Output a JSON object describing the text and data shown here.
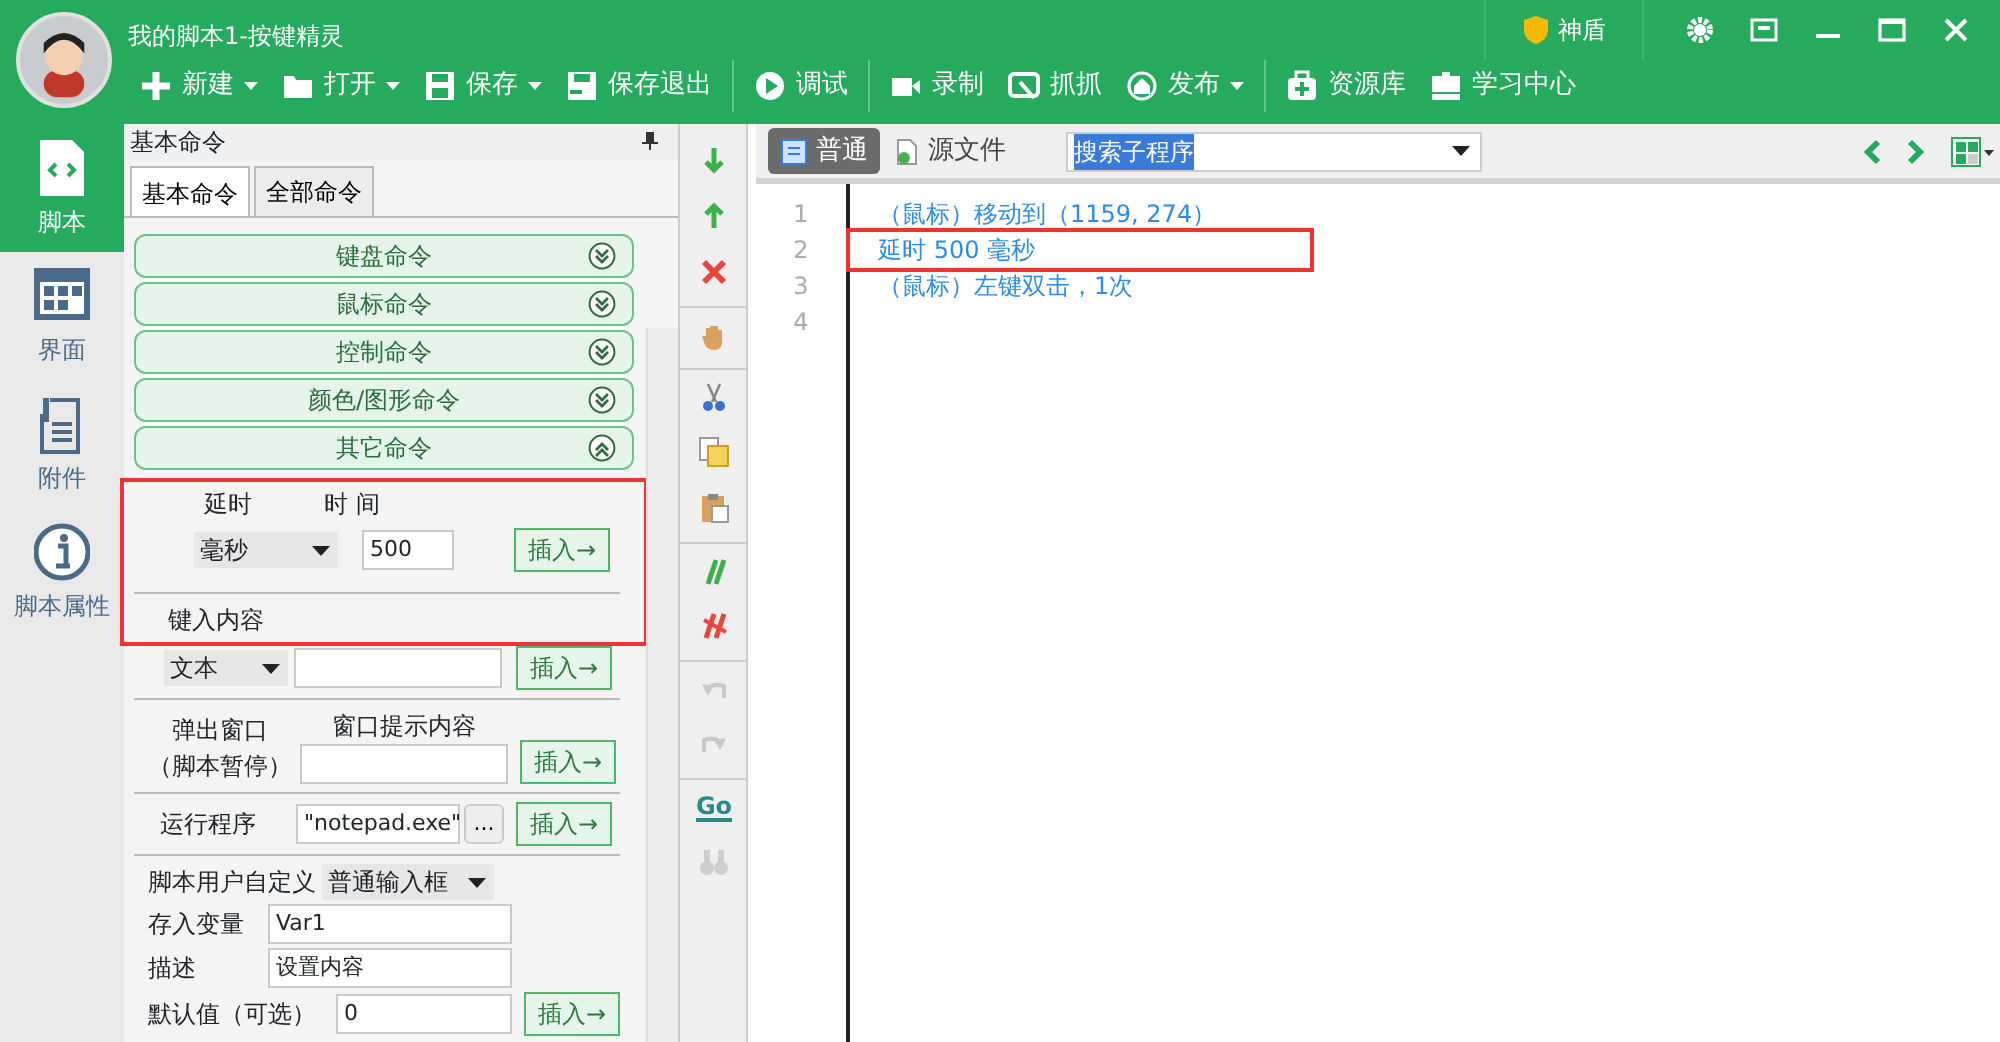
{
  "window": {
    "title": "我的脚本1-按键精灵",
    "shield": "神盾"
  },
  "toolbar": [
    {
      "label": "新建",
      "dropdown": true,
      "separator_before": false
    },
    {
      "label": "打开",
      "dropdown": true,
      "separator_before": false
    },
    {
      "label": "保存",
      "dropdown": true,
      "separator_before": false
    },
    {
      "label": "保存退出",
      "dropdown": false,
      "separator_before": false
    },
    {
      "label": "调试",
      "dropdown": false,
      "separator_before": true
    },
    {
      "label": "录制",
      "dropdown": false,
      "separator_before": true
    },
    {
      "label": "抓抓",
      "dropdown": false,
      "separator_before": false
    },
    {
      "label": "发布",
      "dropdown": true,
      "separator_before": false
    },
    {
      "label": "资源库",
      "dropdown": false,
      "separator_before": true
    },
    {
      "label": "学习中心",
      "dropdown": false,
      "separator_before": false
    }
  ],
  "sidebar": {
    "items": [
      {
        "label": "脚本",
        "selected": true
      },
      {
        "label": "界面",
        "selected": false
      },
      {
        "label": "附件",
        "selected": false
      },
      {
        "label": "脚本属性",
        "selected": false
      }
    ]
  },
  "panel": {
    "title": "基本命令",
    "tabs": [
      {
        "label": "基本命令",
        "selected": true
      },
      {
        "label": "全部命令",
        "selected": false
      }
    ],
    "categories": [
      {
        "label": "键盘命令",
        "expanded": false
      },
      {
        "label": "鼠标命令",
        "expanded": false
      },
      {
        "label": "控制命令",
        "expanded": false
      },
      {
        "label": "颜色/图形命令",
        "expanded": false
      },
      {
        "label": "其它命令",
        "expanded": true
      }
    ],
    "delay": {
      "label": "延时",
      "time_label": "时 间",
      "unit": "毫秒",
      "value": "500",
      "button": "插入→",
      "highlighted": true
    },
    "keyin": {
      "label": "键入内容",
      "type": "文本",
      "button": "插入→"
    },
    "popup": {
      "label_1": "弹出窗口",
      "label_2": "（脚本暂停）",
      "content_label": "窗口提示内容",
      "button": "插入→"
    },
    "run": {
      "label": "运行程序",
      "value": "\"notepad.exe\"",
      "browse": "...",
      "button": "插入→"
    },
    "custom": {
      "label": "脚本用户自定义",
      "type": "普通输入框",
      "fields": [
        {
          "label": "存入变量",
          "value": "Var1"
        },
        {
          "label": "描述",
          "value": "设置内容"
        },
        {
          "label": "默认值（可选）",
          "value": "0"
        }
      ],
      "button": "插入→"
    }
  },
  "tools": [
    {
      "kind": "down",
      "disabled": false,
      "separator_before": false
    },
    {
      "kind": "up",
      "disabled": false,
      "separator_before": false
    },
    {
      "kind": "delete",
      "disabled": false,
      "separator_before": false
    },
    {
      "kind": "hand",
      "disabled": false,
      "separator_before": true
    },
    {
      "kind": "cut",
      "disabled": false,
      "separator_before": true
    },
    {
      "kind": "copy",
      "disabled": false,
      "separator_before": false
    },
    {
      "kind": "paste",
      "disabled": false,
      "separator_before": false
    },
    {
      "kind": "comment",
      "disabled": false,
      "separator_before": true
    },
    {
      "kind": "uncomment",
      "disabled": false,
      "separator_before": false
    },
    {
      "kind": "undo",
      "disabled": true,
      "separator_before": true
    },
    {
      "kind": "redo",
      "disabled": true,
      "separator_before": false
    },
    {
      "kind": "go",
      "label": "Go",
      "disabled": false,
      "separator_before": true
    },
    {
      "kind": "find",
      "disabled": true,
      "separator_before": false
    }
  ],
  "editor": {
    "views": [
      {
        "label": "普通",
        "selected": true
      },
      {
        "label": "源文件",
        "selected": false
      }
    ],
    "search": "搜索子程序",
    "lines": [
      {
        "number": "1",
        "text": "（鼠标）移动到（1159, 274）",
        "highlighted": false
      },
      {
        "number": "2",
        "text": "延时 500 毫秒",
        "highlighted": true
      },
      {
        "number": "3",
        "text": "（鼠标）左键双击，1次",
        "highlighted": false
      },
      {
        "number": "4",
        "highlighted": false
      }
    ]
  }
}
